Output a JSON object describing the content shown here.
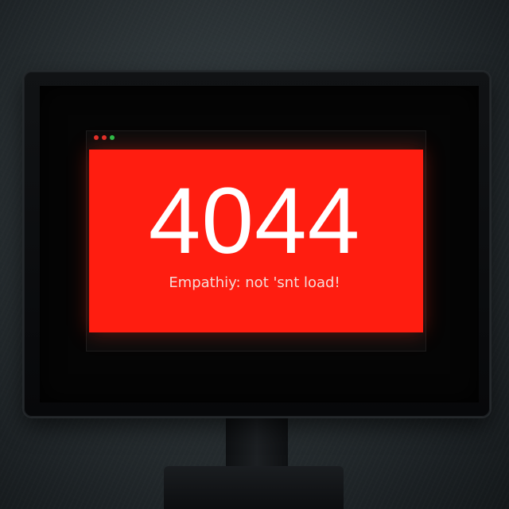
{
  "error": {
    "code": "4044",
    "message": "Empathiy: not 'snt load!"
  },
  "window_controls": [
    {
      "name": "close-dot",
      "color": "#e0302a"
    },
    {
      "name": "minimize-dot",
      "color": "#e0302a"
    },
    {
      "name": "maximize-dot",
      "color": "#29c04a"
    }
  ],
  "colors": {
    "error_panel": "#ff1d10",
    "text": "#ffffff",
    "bezel": "#0b0c0e"
  }
}
